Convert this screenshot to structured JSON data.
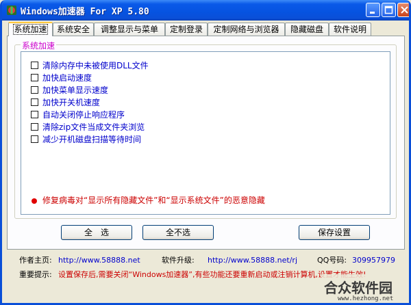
{
  "window": {
    "title": "Windows加速器 For XP 5.80"
  },
  "tabs": [
    {
      "label": "系统加速",
      "active": true
    },
    {
      "label": "系统安全"
    },
    {
      "label": "调整显示与菜单"
    },
    {
      "label": "定制登录"
    },
    {
      "label": "定制网络与浏览器"
    },
    {
      "label": "隐藏磁盘"
    },
    {
      "label": "软件说明"
    }
  ],
  "group": {
    "title": "系统加速",
    "options": [
      {
        "label": "清除内存中未被使用DLL文件",
        "checked": false
      },
      {
        "label": "加快启动速度",
        "checked": false
      },
      {
        "label": "加快菜单显示速度",
        "checked": false
      },
      {
        "label": "加快开关机速度",
        "checked": false
      },
      {
        "label": "自动关闭停止响应程序",
        "checked": false
      },
      {
        "label": "清除zip文件当成文件夹浏览",
        "checked": false
      },
      {
        "label": "减少开机磁盘扫描等待时间",
        "checked": false
      }
    ],
    "warning": "修复病毒对“显示所有隐藏文件”和“显示系统文件”的恶意隐藏"
  },
  "buttons": {
    "select_all": "全　选",
    "select_none": "全不选",
    "save": "保存设置"
  },
  "footer": {
    "homepage_label": "作者主页:",
    "homepage_url": "http://www.58888.net",
    "upgrade_label": "软件升级:",
    "upgrade_url": "http://www.58888.net/rj",
    "qq_label": "QQ号码:",
    "qq_value": "309957979",
    "notice_label": "重要提示:",
    "notice_text": "设置保存后,需要关闭“Windows加速器”,有些功能还要重新启动或注销计算机,设置才能生效!"
  },
  "watermark": {
    "text": "合众软件园",
    "url": "www.hezhong.net"
  },
  "colors": {
    "titlebar": "#0a59e8",
    "link": "#0000cc",
    "warning": "#cc0000",
    "group_title": "#cc00cc"
  }
}
